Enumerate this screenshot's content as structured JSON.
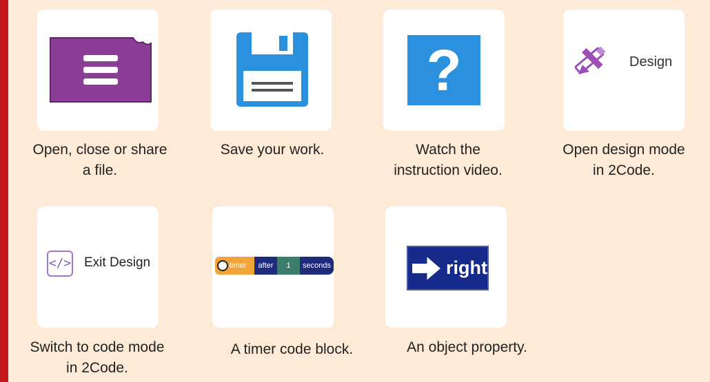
{
  "items": [
    {
      "icon": "file-menu-icon",
      "caption_lines": [
        "Open, close or share",
        "a file."
      ]
    },
    {
      "icon": "save-icon",
      "caption_lines": [
        "Save your work."
      ]
    },
    {
      "icon": "help-icon",
      "glyph": "?",
      "caption_lines": [
        "Watch the",
        "instruction video."
      ]
    },
    {
      "icon": "design-pencil-icon",
      "button_label": "Design",
      "caption_lines": [
        "Open design mode",
        "in 2Code."
      ]
    },
    {
      "icon": "code-brackets-icon",
      "glyph": "</>",
      "button_label": "Exit Design",
      "caption_lines": [
        "Switch to code mode",
        "in 2Code."
      ]
    },
    {
      "icon": "stopwatch-icon",
      "block": {
        "timer": "timer",
        "after": "after",
        "number": "1",
        "seconds": "seconds"
      },
      "caption_lines": [
        "A timer code block."
      ]
    },
    {
      "icon": "arrow-right-icon",
      "property_label": "right",
      "caption_lines": [
        "An object property."
      ]
    }
  ],
  "colors": {
    "background": "#fdebd7",
    "accent_bar": "#c3161c",
    "file_purple": "#8a3e96",
    "save_blue": "#2b90de"
  }
}
